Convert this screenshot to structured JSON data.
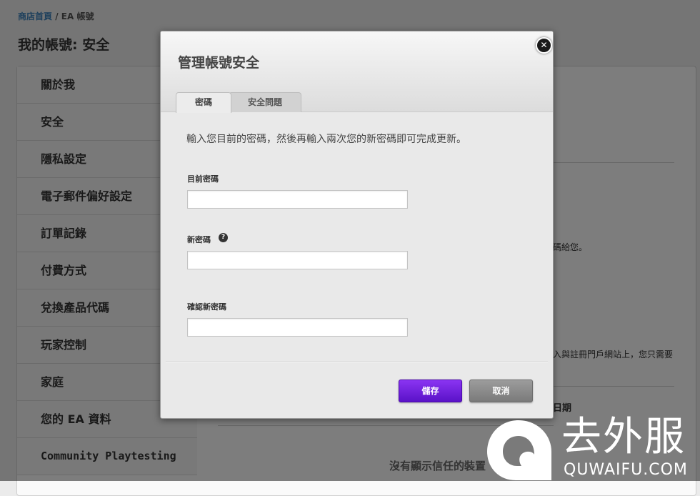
{
  "breadcrumb": {
    "home": "商店首頁",
    "separator": "/",
    "current": "EA 帳號"
  },
  "page_title": "我的帳號: 安全",
  "sidebar": {
    "items": [
      {
        "label": "關於我"
      },
      {
        "label": "安全"
      },
      {
        "label": "隱私設定"
      },
      {
        "label": "電子郵件偏好設定"
      },
      {
        "label": "訂單記錄"
      },
      {
        "label": "付費方式"
      },
      {
        "label": "兌換產品代碼"
      },
      {
        "label": "玩家控制"
      },
      {
        "label": "家庭"
      },
      {
        "label": "您的 EA 資料"
      },
      {
        "label": "Community Playtesting"
      }
    ]
  },
  "background": {
    "text1": "碼給您。",
    "text2": "入與註冊門戶網站上，您只需要",
    "text3": "日期",
    "empty_state": "沒有顯示信任的裝置"
  },
  "modal": {
    "title": "管理帳號安全",
    "close_icon": "close-icon",
    "tabs": [
      {
        "label": "密碼",
        "active": true
      },
      {
        "label": "安全問題",
        "active": false
      }
    ],
    "description": "輸入您目前的密碼，然後再輸入兩次您的新密碼即可完成更新。",
    "fields": {
      "current_password": {
        "label": "目前密碼",
        "value": ""
      },
      "new_password": {
        "label": "新密碼",
        "value": "",
        "help_icon": "question-circle-icon"
      },
      "confirm_password": {
        "label": "確認新密碼",
        "value": ""
      }
    },
    "save_label": "儲存",
    "cancel_label": "取消"
  },
  "watermark": {
    "chinese": "去外服",
    "english": "QUWAIFU.COM"
  },
  "colors": {
    "accent_purple": "#6a1fd9",
    "link_blue": "#3a7fb8",
    "cancel_gray": "#8a8a8a",
    "overlay": "rgba(0,0,0,0.5)"
  }
}
